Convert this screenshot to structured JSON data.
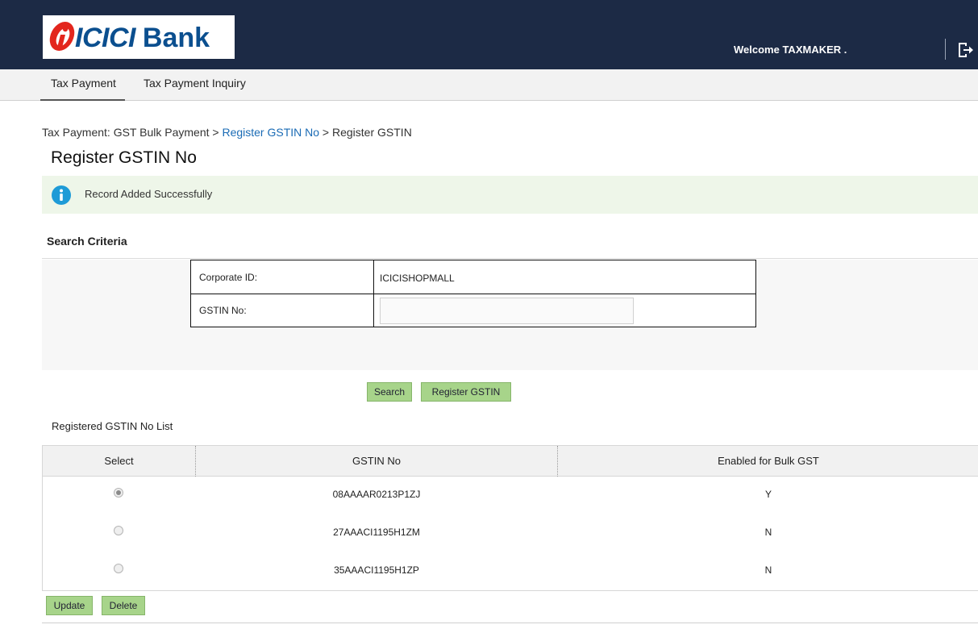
{
  "header": {
    "logo_brand": "ICICI",
    "logo_bank": "Bank",
    "welcome_text": "Welcome  TAXMAKER .",
    "logout_icon": "logout-icon",
    "bg_color": "#1c2a45"
  },
  "nav": {
    "items": [
      {
        "label": "Tax Payment",
        "active": true
      },
      {
        "label": "Tax Payment Inquiry",
        "active": false
      }
    ]
  },
  "breadcrumb": {
    "part1": "Tax Payment: GST Bulk Payment > ",
    "link": "Register GSTIN No",
    "part2": " > Register GSTIN"
  },
  "page_title": "Register GSTIN No",
  "message": {
    "icon": "info-icon",
    "text": "Record Added Successfully",
    "bg_color": "#eef6e9"
  },
  "search": {
    "title": "Search Criteria",
    "corporate_id_label": "Corporate ID:",
    "corporate_id_value": "ICICISHOPMALL",
    "gstin_label": "GSTIN No:",
    "gstin_value": "",
    "search_button": "Search",
    "register_button": "Register GSTIN"
  },
  "list": {
    "title": "Registered GSTIN No List",
    "columns": [
      "Select",
      "GSTIN No",
      "Enabled for Bulk GST"
    ],
    "rows": [
      {
        "selected": true,
        "gstin": "08AAAAR0213P1ZJ",
        "enabled": "Y"
      },
      {
        "selected": false,
        "gstin": "27AAACI1195H1ZM",
        "enabled": "N"
      },
      {
        "selected": false,
        "gstin": "35AAACI1195H1ZP",
        "enabled": "N"
      }
    ],
    "update_button": "Update",
    "delete_button": "Delete"
  },
  "colors": {
    "button_green": "#a7d48a",
    "link_blue": "#1a6bb5"
  }
}
